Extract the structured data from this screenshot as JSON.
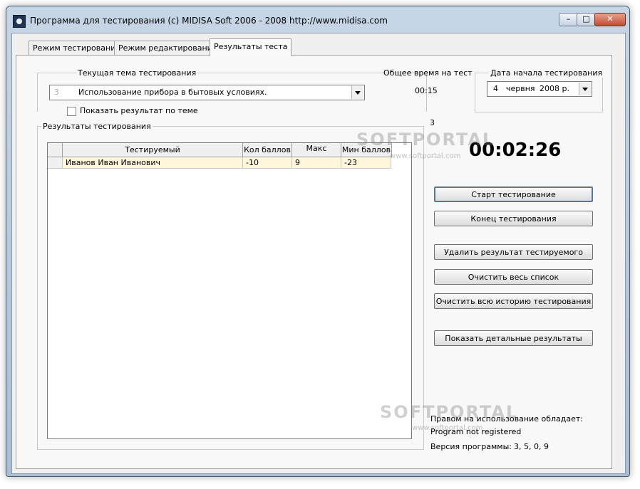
{
  "window": {
    "title": "Программа для тестирования (c) MIDISA Soft 2006 - 2008 http://www.midisa.com",
    "min_glyph": "–",
    "max_glyph": "□",
    "close_glyph": "✕"
  },
  "tabs": [
    {
      "label": "Режим тестирования"
    },
    {
      "label": "Режим редактирования"
    },
    {
      "label": "Результаты теста",
      "active": true
    }
  ],
  "topic": {
    "legend": "Текущая тема тестирования",
    "number": "3",
    "value": "Использование прибора в бытовых условиях.",
    "show_by_topic_label": "Показать результат по теме"
  },
  "total_time": {
    "label": "Общее время на тест",
    "value": "00:15"
  },
  "start_date": {
    "legend": "Дата начала тестирования",
    "day": "4",
    "month": "червня",
    "year": "2008 р."
  },
  "results": {
    "legend": "Результаты тестирования",
    "columns": [
      "Тестируемый",
      "Кол баллов",
      "Макс",
      "Мин баллов"
    ],
    "rows": [
      [
        "Иванов Иван Иванович",
        "-10",
        "9",
        "-23"
      ]
    ]
  },
  "counter": "3",
  "timer": "00:02:26",
  "buttons": {
    "start": "Старт тестирование",
    "end": "Конец тестирования",
    "delete_result": "Удалить результат тестируемого",
    "clear_list": "Очистить весь список",
    "clear_history": "Очистить всю историю тестирования",
    "show_details": "Показать детальные результаты"
  },
  "footer": {
    "rights_label": "Правом на использование обладает:",
    "registered": "Program not registered",
    "version_label": "Версия программы:",
    "version_value": "3, 5, 0, 9"
  },
  "watermarks": {
    "brand": "SOFTPORTAL",
    "url": "www.softportal.com"
  }
}
